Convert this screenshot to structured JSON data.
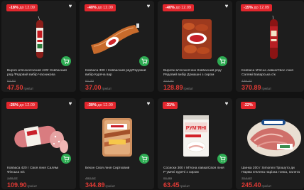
{
  "colors": {
    "background": "#121212",
    "card": "#1d1d1d",
    "badge": "#e3262d",
    "price": "#e03a35",
    "cart": "#2eac53"
  },
  "products": [
    {
      "badge_pct": "-18%",
      "badge_until": "до 12.09",
      "name": "Вироб м'ясокопчений 420г Ковбасний ряд /Рядовий вибір Часникова",
      "old_price": "57.92",
      "price": "47.50",
      "unit": "грн/шт",
      "icons": {
        "fav": "heart-icon",
        "cart": "cart-icon"
      }
    },
    {
      "badge_pct": "-40%",
      "badge_until": "до 12.09",
      "name": "Ковбаса 300 г Ковбасний ряд/Рядовий вибір Курячa вар",
      "old_price": "61.70",
      "price": "37.00",
      "unit": "грн/шт",
      "icons": {
        "fav": "heart-icon",
        "cart": "cart-icon"
      }
    },
    {
      "badge_pct": "-40%",
      "badge_until": "до 12.09",
      "name": "Вироби м'ясокопчені Ковбасний ряд/Рядовий вибір Домашні з сиром",
      "old_price": "214.97",
      "price": "128.89",
      "unit": "грн/шт",
      "icons": {
        "fav": "heart-icon",
        "cart": "cart-icon"
      }
    },
    {
      "badge_pct": "-15%",
      "badge_until": "до 12.09",
      "name": "Ковбаса М'ясна лавка/Своє лінія Салямі Баварська с/к",
      "old_price": "436.27",
      "price": "370.89",
      "unit": "грн/шт",
      "icons": {
        "fav": "heart-icon",
        "cart": "cart-icon"
      }
    },
    {
      "badge_pct": "-26%",
      "badge_until": "до 12.09",
      "name": "Ковбаса 420 г Своя лінія Салямі Фінська н/к",
      "old_price": "148.27",
      "price": "109.90",
      "unit": "грн/шт",
      "icons": {
        "fav": "heart-icon",
        "cart": "cart-icon"
      }
    },
    {
      "badge_pct": "-30%",
      "badge_until": "до 12.09",
      "name": "Бекон Своя лінія Сиртковий",
      "old_price": "492.57",
      "price": "344.89",
      "unit": "грн/шт",
      "icons": {
        "fav": "heart-icon",
        "cart": "cart-icon"
      }
    },
    {
      "badge_pct": "-31%",
      "badge_until": "",
      "name": "Сосиски 300 г М'ясна лавка/Своя лінія Р умяні курячі з сиром",
      "old_price": "91.99",
      "price": "63.45",
      "unit": "грн/шт",
      "icons": {
        "fav": "heart-icon",
        "cart": "cart-icon"
      }
    },
    {
      "badge_pct": "-22%",
      "badge_until": "",
      "name": "Шинка 200 г Simonini Прошуто ди Парма в'ялена нарізка тонка, палета",
      "old_price": "314.67",
      "price": "245.40",
      "unit": "грн/шт",
      "icons": {
        "fav": "heart-icon",
        "cart": "cart-icon"
      }
    }
  ]
}
